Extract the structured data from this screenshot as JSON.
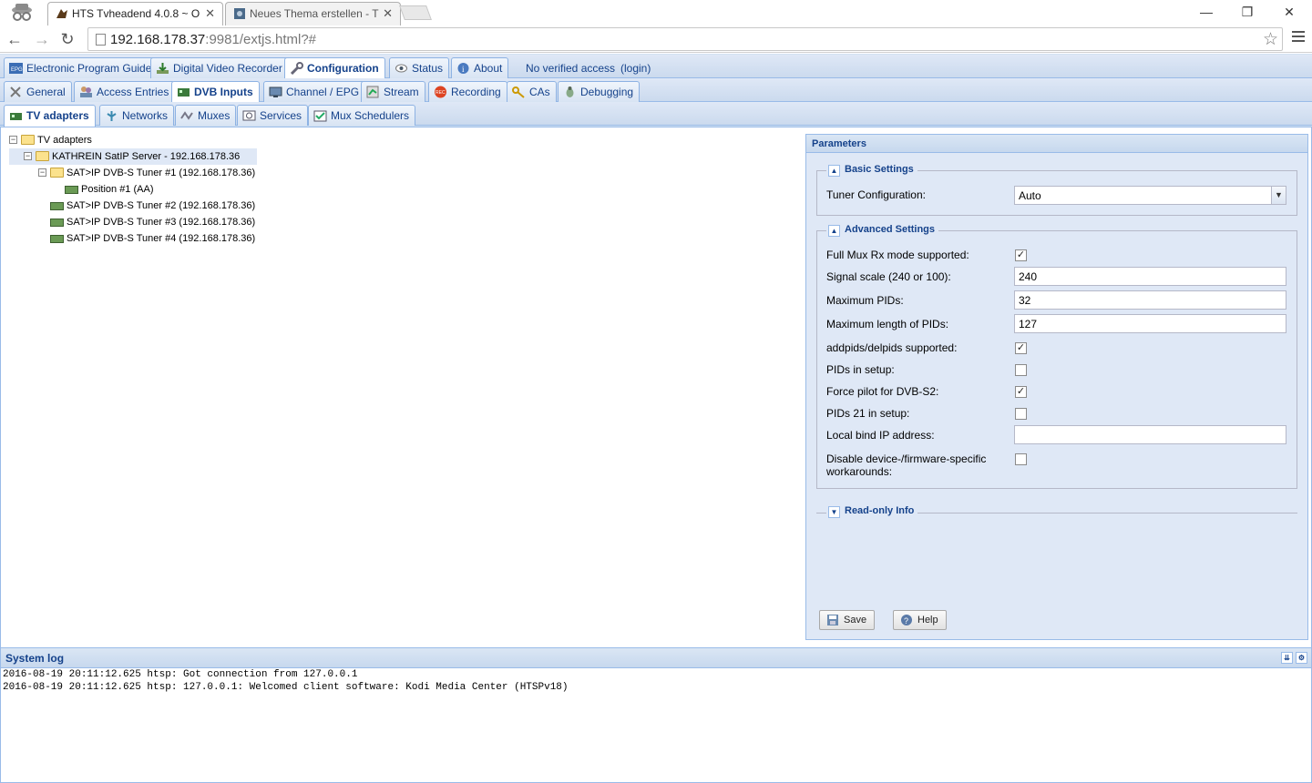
{
  "browser": {
    "tabs": [
      {
        "title": "HTS Tvheadend 4.0.8 ~ O"
      },
      {
        "title": "Neues Thema erstellen - T"
      }
    ],
    "url_host": "192.168.178.37",
    "url_rest": ":9981/extjs.html?#"
  },
  "topnav": {
    "tabs": [
      "Electronic Program Guide",
      "Digital Video Recorder",
      "Configuration",
      "Status",
      "About"
    ],
    "access_text": "No verified access",
    "login_text": "(login)"
  },
  "confignav": {
    "tabs": [
      "General",
      "Access Entries",
      "DVB Inputs",
      "Channel / EPG",
      "Stream",
      "Recording",
      "CAs",
      "Debugging"
    ]
  },
  "dvbnav": {
    "tabs": [
      "TV adapters",
      "Networks",
      "Muxes",
      "Services",
      "Mux Schedulers"
    ]
  },
  "tree": {
    "root": "TV adapters",
    "server": "KATHREIN SatIP Server - 192.168.178.36",
    "tuner1": "SAT>IP DVB-S Tuner #1 (192.168.178.36)",
    "position1": "Position #1 (AA)",
    "tuner2": "SAT>IP DVB-S Tuner #2 (192.168.178.36)",
    "tuner3": "SAT>IP DVB-S Tuner #3 (192.168.178.36)",
    "tuner4": "SAT>IP DVB-S Tuner #4 (192.168.178.36)"
  },
  "params": {
    "title": "Parameters",
    "basic": {
      "legend": "Basic Settings",
      "tuner_config_label": "Tuner Configuration:",
      "tuner_config_value": "Auto"
    },
    "advanced": {
      "legend": "Advanced Settings",
      "full_mux_label": "Full Mux Rx mode supported:",
      "full_mux_checked": true,
      "signal_scale_label": "Signal scale (240 or 100):",
      "signal_scale_value": "240",
      "max_pids_label": "Maximum PIDs:",
      "max_pids_value": "32",
      "max_pid_len_label": "Maximum length of PIDs:",
      "max_pid_len_value": "127",
      "addpids_label": "addpids/delpids supported:",
      "addpids_checked": true,
      "pids_setup_label": "PIDs in setup:",
      "pids_setup_checked": false,
      "force_pilot_label": "Force pilot for DVB-S2:",
      "force_pilot_checked": true,
      "pids21_label": "PIDs 21 in setup:",
      "pids21_checked": false,
      "local_bind_label": "Local bind IP address:",
      "local_bind_value": "",
      "disable_fw_label_1": "Disable device-/firmware-specific",
      "disable_fw_label_2": "workarounds:",
      "disable_fw_checked": false
    },
    "readonly_legend": "Read-only Info",
    "save_label": "Save",
    "help_label": "Help"
  },
  "syslog": {
    "title": "System log",
    "lines": [
      "2016-08-19 20:11:12.625 htsp: Got connection from 127.0.0.1",
      "2016-08-19 20:11:12.625 htsp: 127.0.0.1: Welcomed client software: Kodi Media Center (HTSPv18)"
    ]
  },
  "icons": {
    "incognito": "incognito-icon",
    "brand_accent": "#15428b",
    "panel_bg": "#dfe8f6"
  }
}
